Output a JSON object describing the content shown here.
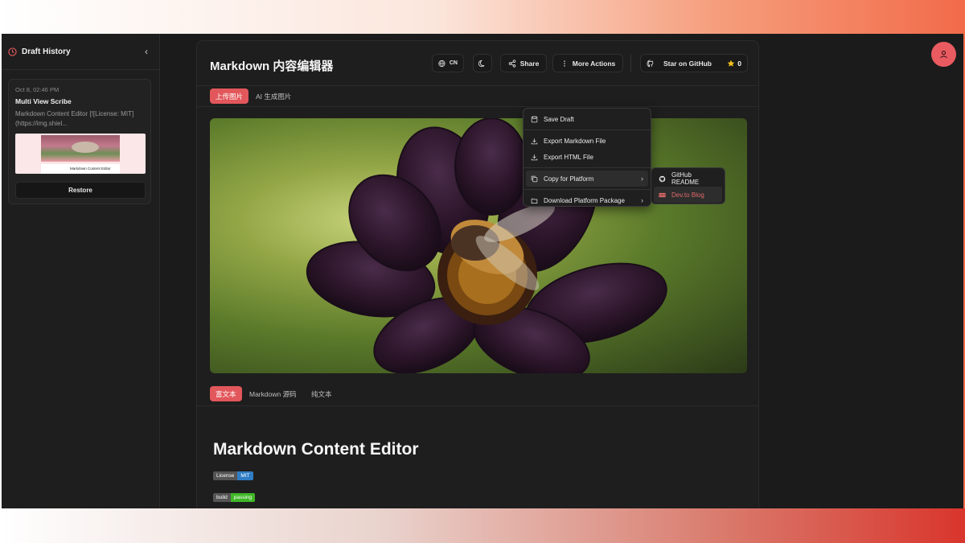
{
  "sidebar": {
    "title": "Draft History",
    "draft": {
      "date": "Oct 8, 02:46 PM",
      "name": "Multi View Scribe",
      "excerpt": "Markdown Content Editor [![License: MIT](https://img.shiel...",
      "thumb_caption": "Markdown Content Editor",
      "restore_label": "Restore"
    }
  },
  "header": {
    "title": "Markdown 内容编辑器",
    "lang_label": "CN",
    "share_label": "Share",
    "more_label": "More Actions",
    "github_label": "Star on GitHub",
    "star_count": "0"
  },
  "upload_tabs": [
    "上传图片",
    "AI 生成图片"
  ],
  "view_tabs": [
    "富文本",
    "Markdown 源码",
    "纯文本"
  ],
  "document": {
    "heading": "Markdown Content Editor",
    "badges": [
      {
        "left": "License",
        "right": "MIT",
        "color": "#2f7dc4"
      },
      {
        "left": "build",
        "right": "passing",
        "color": "#3fb626"
      }
    ]
  },
  "menu": {
    "items": [
      {
        "label": "Save Draft",
        "icon": "save-icon"
      },
      {
        "label": "Export Markdown File",
        "icon": "download-icon"
      },
      {
        "label": "Export HTML File",
        "icon": "download-icon"
      },
      {
        "label": "Copy for Platform",
        "icon": "copy-icon"
      },
      {
        "label": "Download Platform Package",
        "icon": "package-icon"
      }
    ],
    "submenu": [
      {
        "label": "GitHub README",
        "icon": "github-icon"
      },
      {
        "label": "Dev.to Blog",
        "icon": "devto-icon"
      }
    ]
  },
  "colors": {
    "accent": "#e2575b",
    "background": "#1b1b1b"
  }
}
